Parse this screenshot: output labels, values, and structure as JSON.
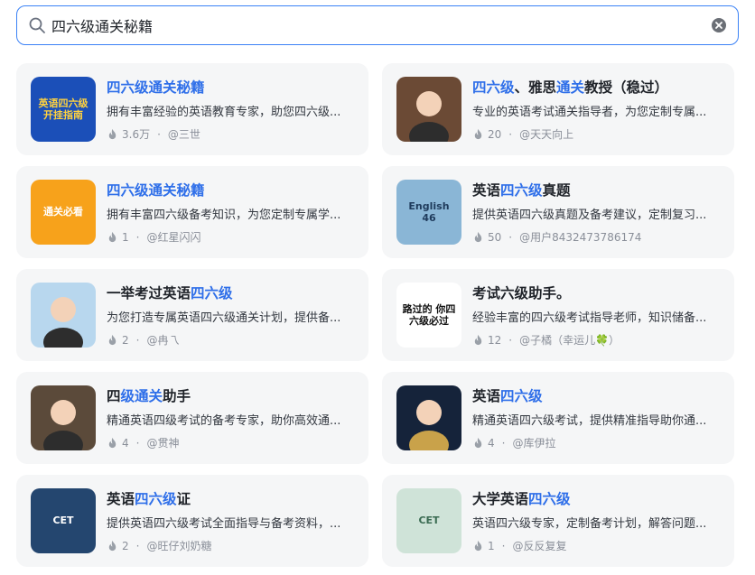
{
  "search": {
    "value": "四六级通关秘籍"
  },
  "cards": [
    {
      "title": [
        {
          "t": "四六级通关秘籍",
          "hl": true
        }
      ],
      "desc": "拥有丰富经验的英语教育专家，助您四六级...",
      "count": "3.6万",
      "author": "@三世",
      "avatar": {
        "bg": "#1b4fb8",
        "label": "英语四六级开挂指南",
        "fg": "#ffd23f"
      }
    },
    {
      "title": [
        {
          "t": "四六级",
          "hl": true
        },
        {
          "t": "、雅思",
          "hl": false
        },
        {
          "t": "通关",
          "hl": true
        },
        {
          "t": "教授（稳过）",
          "hl": false
        }
      ],
      "desc": "专业的英语考试通关指导者，为您定制专属...",
      "count": "20",
      "author": "@天天向上",
      "avatar": {
        "bg": "#6b4a35",
        "label": "",
        "fg": "#fff"
      }
    },
    {
      "title": [
        {
          "t": "四六级通关秘籍",
          "hl": true
        }
      ],
      "desc": "拥有丰富四六级备考知识，为您定制专属学...",
      "count": "1",
      "author": "@红星闪闪",
      "avatar": {
        "bg": "#f7a21b",
        "label": "通关必看",
        "fg": "#fff"
      }
    },
    {
      "title": [
        {
          "t": "英语",
          "hl": false
        },
        {
          "t": "四六级",
          "hl": true
        },
        {
          "t": "真题",
          "hl": false
        }
      ],
      "desc": "提供英语四六级真题及备考建议，定制复习...",
      "count": "50",
      "author": "@用户8432473786174",
      "avatar": {
        "bg": "#8ab6d6",
        "label": "English 46",
        "fg": "#1f3b5c"
      }
    },
    {
      "title": [
        {
          "t": "一举考过英语",
          "hl": false
        },
        {
          "t": "四六级",
          "hl": true
        }
      ],
      "desc": "为您打造专属英语四六级通关计划，提供备...",
      "count": "2",
      "author": "@冉乁",
      "avatar": {
        "bg": "#b8d7ee",
        "label": "",
        "fg": "#fff"
      }
    },
    {
      "title": [
        {
          "t": "考试六级助手。",
          "hl": false
        }
      ],
      "desc": "经验丰富的四六级考试指导老师，知识储备...",
      "count": "12",
      "author": "@子橘（幸运儿🍀）",
      "avatar": {
        "bg": "#ffffff",
        "label": "路过的 你四六级必过",
        "fg": "#111"
      }
    },
    {
      "title": [
        {
          "t": "四",
          "hl": false
        },
        {
          "t": "级通关",
          "hl": true
        },
        {
          "t": "助手",
          "hl": false
        }
      ],
      "desc": "精通英语四级考试的备考专家，助你高效通...",
      "count": "4",
      "author": "@贯神",
      "avatar": {
        "bg": "#5b4a3a",
        "label": "",
        "fg": "#fff"
      }
    },
    {
      "title": [
        {
          "t": "英语",
          "hl": false
        },
        {
          "t": "四六级",
          "hl": true
        }
      ],
      "desc": "精通英语四六级考试，提供精准指导助你通...",
      "count": "4",
      "author": "@库伊拉",
      "avatar": {
        "bg": "#15233a",
        "label": "",
        "fg": "#f0c060"
      }
    },
    {
      "title": [
        {
          "t": "英语",
          "hl": false
        },
        {
          "t": "四六级",
          "hl": true
        },
        {
          "t": "证",
          "hl": false
        }
      ],
      "desc": "提供英语四六级考试全面指导与备考资料，...",
      "count": "2",
      "author": "@旺仔刘奶糖",
      "avatar": {
        "bg": "#24466f",
        "label": "CET",
        "fg": "#fff"
      }
    },
    {
      "title": [
        {
          "t": "大学英语",
          "hl": false
        },
        {
          "t": "四六级",
          "hl": true
        }
      ],
      "desc": "英语四六级专家，定制备考计划，解答问题...",
      "count": "1",
      "author": "@反反复复",
      "avatar": {
        "bg": "#cfe3d8",
        "label": "CET",
        "fg": "#3a6b52"
      }
    }
  ]
}
